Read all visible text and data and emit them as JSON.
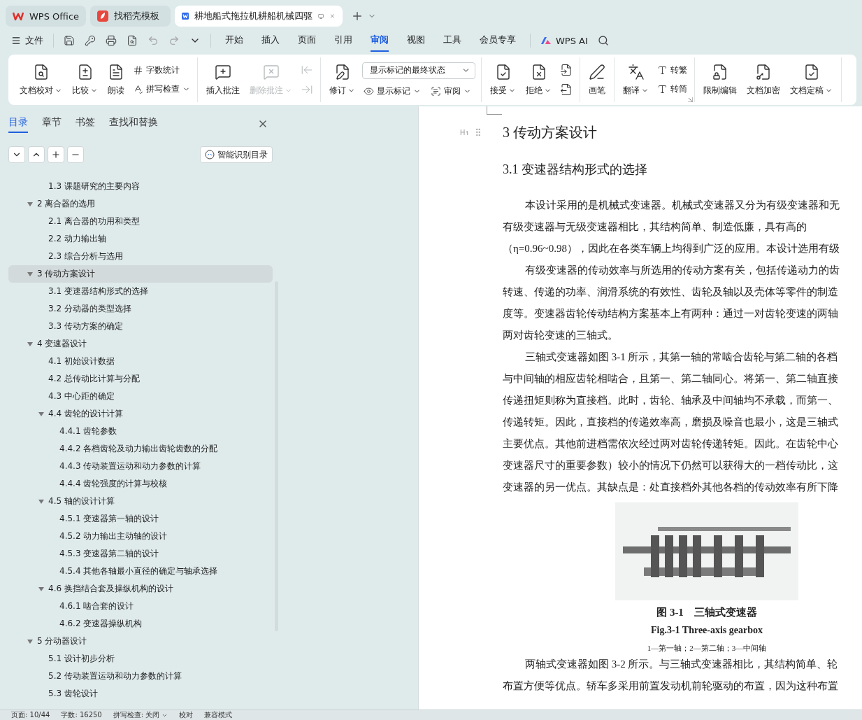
{
  "tabs": [
    {
      "label": "WPS Office",
      "kind": "home",
      "selected": false
    },
    {
      "label": "找稻壳模板",
      "kind": "template",
      "selected": false
    },
    {
      "label": "耕地船式拖拉机耕船机械四驱",
      "kind": "document",
      "selected": true
    }
  ],
  "menu": {
    "file": "文件",
    "tabs": [
      {
        "label": "开始",
        "selected": false
      },
      {
        "label": "插入",
        "selected": false
      },
      {
        "label": "页面",
        "selected": false
      },
      {
        "label": "引用",
        "selected": false
      },
      {
        "label": "审阅",
        "selected": true
      },
      {
        "label": "视图",
        "selected": false
      },
      {
        "label": "工具",
        "selected": false
      },
      {
        "label": "会员专享",
        "selected": false
      }
    ],
    "ai": "WPS AI"
  },
  "ribbon": [
    {
      "items": [
        {
          "kind": "large",
          "label": "文档校对",
          "dropdown": true,
          "disabled": false
        },
        {
          "kind": "large",
          "label": "比较",
          "dropdown": true,
          "disabled": false
        },
        {
          "kind": "large",
          "label": "朗读",
          "dropdown": false,
          "disabled": false
        },
        {
          "kind": "small",
          "label": "字数统计",
          "dropdown": false,
          "disabled": false
        },
        {
          "kind": "small",
          "label": "拼写检查",
          "dropdown": true,
          "disabled": false
        }
      ]
    },
    {
      "items": [
        {
          "kind": "large",
          "label": "插入批注",
          "dropdown": false,
          "disabled": false
        },
        {
          "kind": "large",
          "label": "删除批注",
          "dropdown": true,
          "disabled": true
        },
        {
          "kind": "icon",
          "disabled": true
        },
        {
          "kind": "icon",
          "disabled": true
        }
      ]
    },
    {
      "items": [
        {
          "kind": "large",
          "label": "修订",
          "dropdown": true,
          "disabled": false
        },
        {
          "kind": "select",
          "label": "显示标记的最终状态",
          "disabled": false
        },
        {
          "kind": "small",
          "label": "显示标记",
          "dropdown": true,
          "disabled": false
        },
        {
          "kind": "small",
          "label": "审阅",
          "dropdown": true,
          "disabled": false
        }
      ]
    },
    {
      "items": [
        {
          "kind": "large",
          "label": "接受",
          "dropdown": true,
          "disabled": false
        },
        {
          "kind": "large",
          "label": "拒绝",
          "dropdown": true,
          "disabled": false
        },
        {
          "kind": "icon",
          "disabled": false
        },
        {
          "kind": "icon",
          "disabled": false
        }
      ]
    },
    {
      "items": [
        {
          "kind": "large",
          "label": "画笔",
          "dropdown": false,
          "disabled": false
        }
      ]
    },
    {
      "items": [
        {
          "kind": "large",
          "label": "翻译",
          "dropdown": true,
          "disabled": false
        },
        {
          "kind": "small",
          "label": "转繁",
          "dropdown": false,
          "disabled": false
        },
        {
          "kind": "small",
          "label": "转简",
          "dropdown": false,
          "disabled": false
        }
      ]
    },
    {
      "items": [
        {
          "kind": "large",
          "label": "限制编辑",
          "dropdown": false,
          "disabled": false
        },
        {
          "kind": "large",
          "label": "文档加密",
          "dropdown": false,
          "disabled": false
        },
        {
          "kind": "large",
          "label": "文档定稿",
          "dropdown": true,
          "disabled": false
        }
      ]
    }
  ],
  "nav": {
    "tabs": [
      {
        "label": "目录",
        "selected": true
      },
      {
        "label": "章节",
        "selected": false
      },
      {
        "label": "书签",
        "selected": false
      },
      {
        "label": "查找和替换",
        "selected": false
      }
    ],
    "smart_button": "智能识别目录",
    "tree": [
      {
        "children": [
          {
            "label": "1.3 课题研究的主要内容",
            "selected": false
          }
        ]
      },
      {
        "label": "2 离合器的选用",
        "selected": false,
        "expanded": true,
        "children": [
          {
            "label": "2.1 离合器的功用和类型",
            "selected": false
          },
          {
            "label": "2.2 动力输出轴",
            "selected": false
          },
          {
            "label": "2.3 综合分析与选用",
            "selected": false
          }
        ]
      },
      {
        "label": "3  传动方案设计",
        "selected": true,
        "expanded": true,
        "children": [
          {
            "label": "3.1  变速器结构形式的选择",
            "selected": false
          },
          {
            "label": "3.2  分动器的类型选择",
            "selected": false
          },
          {
            "label": "3.3  传动方案的确定",
            "selected": false
          }
        ]
      },
      {
        "label": "4  变速器设计",
        "selected": false,
        "expanded": true,
        "children": [
          {
            "label": "4.1  初始设计数据",
            "selected": false
          },
          {
            "label": "4.2  总传动比计算与分配",
            "selected": false
          },
          {
            "label": "4.3  中心距的确定",
            "selected": false
          },
          {
            "label": "4.4  齿轮的设计计算",
            "selected": false,
            "expanded": true,
            "children": [
              {
                "label": "4.4.1  齿轮参数",
                "selected": false
              },
              {
                "label": "4.4.2  各档齿轮及动力输出齿轮齿数的分配",
                "selected": false
              },
              {
                "label": "4.4.3  传动装置运动和动力参数的计算",
                "selected": false
              },
              {
                "label": "4.4.4  齿轮强度的计算与校核",
                "selected": false
              }
            ]
          },
          {
            "label": "4.5  轴的设计计算",
            "selected": false,
            "expanded": true,
            "children": [
              {
                "label": "4.5.1  变速器第一轴的设计",
                "selected": false
              },
              {
                "label": "4.5.2  动力输出主动轴的设计",
                "selected": false
              },
              {
                "label": "4.5.3  变速器第二轴的设计",
                "selected": false
              },
              {
                "label": "4.5.4  其他各轴最小直径的确定与轴承选择",
                "selected": false
              }
            ]
          },
          {
            "label": "4.6  换挡结合套及操纵机构的设计",
            "selected": false,
            "expanded": true,
            "children": [
              {
                "label": "4.6.1  啮合套的设计",
                "selected": false
              },
              {
                "label": "4.6.2  变速器操纵机构",
                "selected": false
              }
            ]
          }
        ]
      },
      {
        "label": "5  分动器设计",
        "selected": false,
        "expanded": true,
        "children": [
          {
            "label": "5.1  设计初步分析",
            "selected": false
          },
          {
            "label": "5.2  传动装置运动和动力参数的计算",
            "selected": false
          },
          {
            "label": "5.3  齿轮设计",
            "selected": false
          }
        ]
      }
    ]
  },
  "document": {
    "heading": "3  传动方案设计",
    "subheading": "3.1  变速器结构形式的选择",
    "lines": [
      {
        "text": "本设计采用的是机械式变速器。机械式变速器又分为有级变速器和无",
        "indent": true
      },
      {
        "text": "有级变速器与无级变速器相比，其结构简单、制造低廉，具有高的",
        "indent": false
      },
      {
        "text": "（η=0.96~0.98），因此在各类车辆上均得到广泛的应用。本设计选用有级",
        "indent": false
      },
      {
        "text": "有级变速器的传动效率与所选用的传动方案有关，包括传递动力的齿",
        "indent": true
      },
      {
        "text": "转速、传递的功率、润滑系统的有效性、齿轮及轴以及壳体等零件的制造",
        "indent": false
      },
      {
        "text": "度等。变速器齿轮传动结构方案基本上有两种：通过一对齿轮变速的两轴",
        "indent": false
      },
      {
        "text": "两对齿轮变速的三轴式。",
        "indent": false
      },
      {
        "text": "三轴式变速器如图 3-1 所示，其第一轴的常啮合齿轮与第二轴的各档",
        "indent": true
      },
      {
        "text": "与中间轴的相应齿轮相啮合，且第一、第二轴同心。将第一、第二轴直接",
        "indent": false
      },
      {
        "text": "传递扭矩则称为直接档。此时，齿轮、轴承及中间轴均不承载，而第一、",
        "indent": false
      },
      {
        "text": "传递转矩。因此，直接档的传递效率高，磨损及噪音也最小，这是三轴式",
        "indent": false
      },
      {
        "text": "主要优点。其他前进档需依次经过两对齿轮传递转矩。因此。在齿轮中心",
        "indent": false
      },
      {
        "text": "变速器尺寸的重要参数）较小的情况下仍然可以获得大的一档传动比，这",
        "indent": false
      },
      {
        "text": "变速器的另一优点。其缺点是：处直接档外其他各档的传动效率有所下降",
        "indent": false
      }
    ],
    "figure": {
      "caption": "图 3-1　三轴式变速器",
      "caption_en": "Fig.3-1 Three-axis gearbox",
      "legend": "1—第一轴；2—第二轴；3—中间轴"
    },
    "lines_after": [
      {
        "text": "两轴式变速器如图 3-2 所示。与三轴式变速器相比，其结构简单、轮",
        "indent": true
      },
      {
        "text": "布置方便等优点。轿车多采用前置发动机前轮驱动的布置，因为这种布置",
        "indent": false
      }
    ]
  },
  "status_bar": [
    {
      "label": "页面: 10/44",
      "dropdown": false
    },
    {
      "label": "字数: 16250",
      "dropdown": false
    },
    {
      "label": "拼写检查: 关闭",
      "dropdown": true
    },
    {
      "label": "校对",
      "dropdown": false
    },
    {
      "label": "兼容模式",
      "dropdown": false
    }
  ]
}
